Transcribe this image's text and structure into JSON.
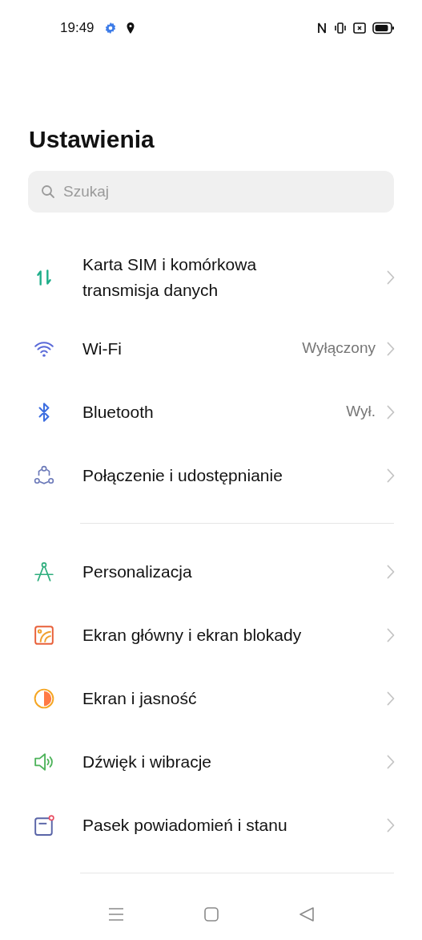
{
  "status_bar": {
    "time": "19:49"
  },
  "title": "Ustawienia",
  "search": {
    "placeholder": "Szukaj"
  },
  "groups": [
    {
      "items": [
        {
          "kind": "sim",
          "label": "Karta SIM i komórkowa transmisja danych"
        },
        {
          "kind": "wifi",
          "label": "Wi-Fi",
          "value": "Wyłączony"
        },
        {
          "kind": "bluetooth",
          "label": "Bluetooth",
          "value": "Wył."
        },
        {
          "kind": "sharing",
          "label": "Połączenie i udostępnianie"
        }
      ]
    },
    {
      "items": [
        {
          "kind": "personalization",
          "label": "Personalizacja"
        },
        {
          "kind": "wallpaper",
          "label": "Ekran główny i ekran blokady"
        },
        {
          "kind": "brightness",
          "label": "Ekran i jasność"
        },
        {
          "kind": "sound",
          "label": "Dźwięk i wibracje"
        },
        {
          "kind": "notifications",
          "label": "Pasek powiadomień i stanu"
        }
      ]
    }
  ]
}
